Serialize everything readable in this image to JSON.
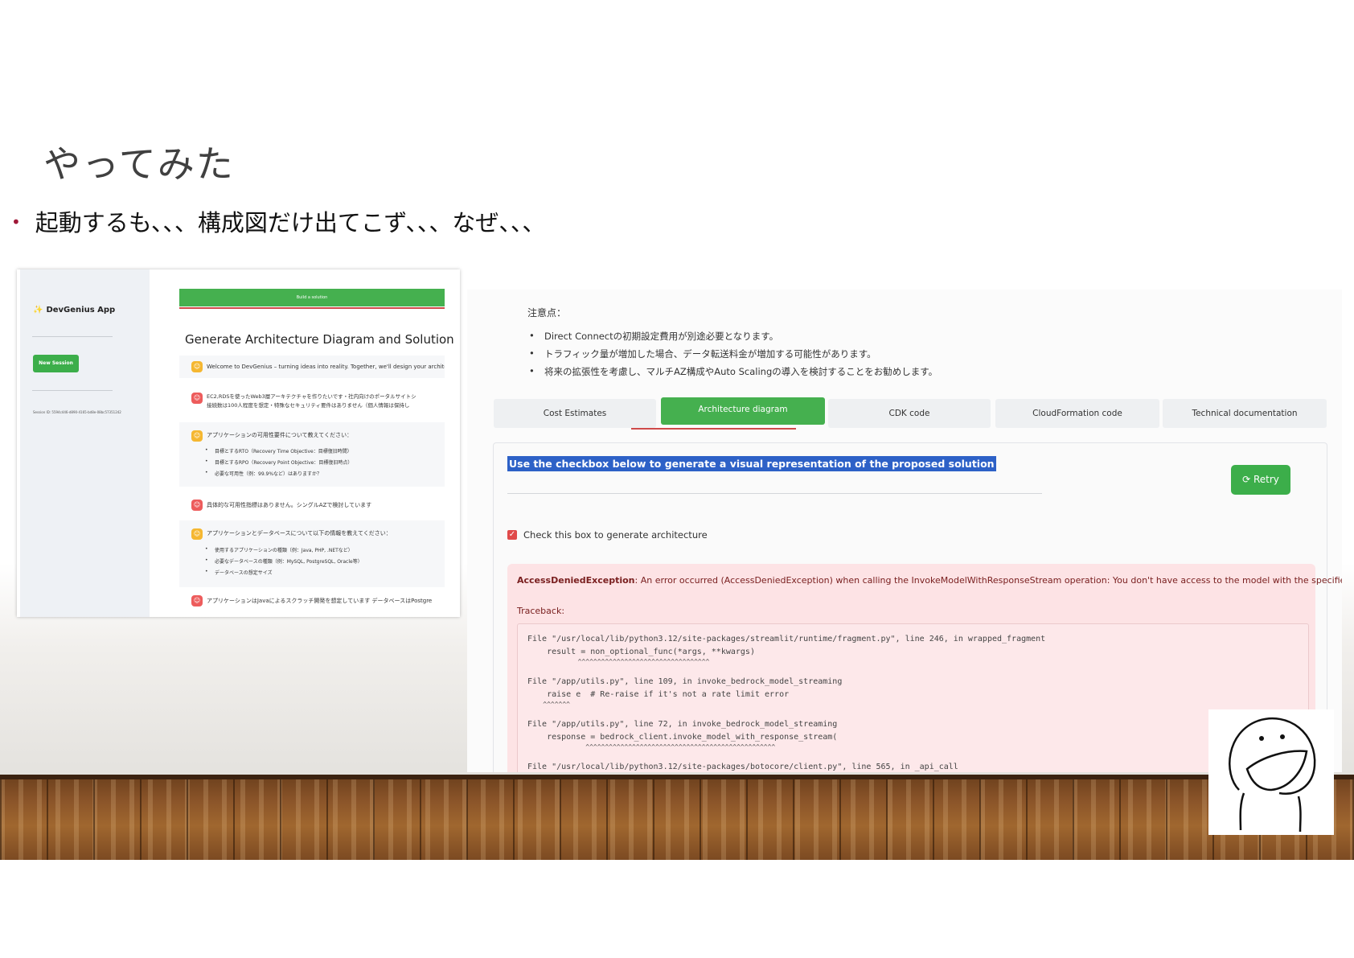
{
  "slide": {
    "title": "やってみた",
    "bullet": "起動するも、、、構成図だけ出てこず、、、なぜ、、、"
  },
  "left_screenshot": {
    "sidebar": {
      "app_name": "DevGenius App",
      "new_session_label": "New Session",
      "session_text": "Session ID: 5594c446-d890-4165-bd8e-08bc57351242"
    },
    "top_button_label": "Build a solution",
    "heading": "Generate Architecture Diagram and Solution",
    "messages": [
      {
        "role": "assistant",
        "text": "Welcome to DevGenius – turning ideas into reality. Together, we'll design your architecture an"
      },
      {
        "role": "user",
        "lines": [
          "EC2,RDSを使ったWeb3層アーキテクチャを作りたいです・社内向けのポータルサイトシ",
          "接続数は100人程度を想定・特殊なセキュリティ要件はありません（個人情報は保持し"
        ]
      },
      {
        "role": "assistant",
        "text": "アプリケーションの可用性要件について教えてください：",
        "items": [
          "目標とするRTO（Recovery Time Objective：目標復旧時間）",
          "目標とするRPO（Recovery Point Objective：目標復旧時点）",
          "必要な可用性（例：99.9%など）はありますか？"
        ]
      },
      {
        "role": "user",
        "text": "具体的な可用性指標はありません。シングルAZで検討しています"
      },
      {
        "role": "assistant",
        "text": "アプリケーションとデータベースについて以下の情報を教えてください：",
        "items": [
          "使用するアプリケーションの種類（例：Java, PHP, .NETなど）",
          "必要なデータベースの種類（例：MySQL, PostgreSQL, Oracle等）",
          "データベースの想定サイズ"
        ]
      },
      {
        "role": "user",
        "text": "アプリケーションはJavaによるスクラッチ開発を想定しています データベースはPostgre"
      }
    ]
  },
  "right_screenshot": {
    "notice_heading": "注意点：",
    "notice_items": [
      "Direct Connectの初期設定費用が別途必要となります。",
      "トラフィック量が増加した場合、データ転送料金が増加する可能性があります。",
      "将来の拡張性を考慮し、マルチAZ構成やAuto Scalingの導入を検討することをお勧めします。"
    ],
    "tabs": [
      "Cost Estimates",
      "Architecture diagram",
      "CDK code",
      "CloudFormation code",
      "Technical documentation"
    ],
    "active_tab": "Architecture diagram",
    "highlight_text": "Use the checkbox below to generate a visual representation of the proposed solution",
    "retry_label": "Retry",
    "checkbox_label": "Check this box to generate architecture",
    "checkbox_checked": true,
    "error": {
      "type": "AccessDeniedException",
      "message": ": An error occurred (AccessDeniedException) when calling the InvokeModelWithResponseStream operation: You don't have access to the model with the specified model ID.",
      "traceback_label": "Traceback:",
      "lines": [
        "File \"/usr/local/lib/python3.12/site-packages/streamlit/runtime/fragment.py\", line 246, in wrapped_fragment",
        "    result = non_optional_func(*args, **kwargs)",
        "             ^^^^^^^^^^^^^^^^^^^^^^^^^^^^^^^^^^",
        "File \"/app/utils.py\", line 109, in invoke_bedrock_model_streaming",
        "    raise e  # Re-raise if it's not a rate limit error",
        "    ^^^^^^^",
        "File \"/app/utils.py\", line 72, in invoke_bedrock_model_streaming",
        "    response = bedrock_client.invoke_model_with_response_stream(",
        "               ^^^^^^^^^^^^^^^^^^^^^^^^^^^^^^^^^^^^^^^^^^^^^^^^^",
        "File \"/usr/local/lib/python3.12/site-packages/botocore/client.py\", line 565, in _api_call"
      ]
    }
  },
  "colors": {
    "accent_green": "#45b04f",
    "highlight_blue": "#2d61c7",
    "error_bg": "#fde3e5",
    "bullet_red": "#a01838"
  }
}
